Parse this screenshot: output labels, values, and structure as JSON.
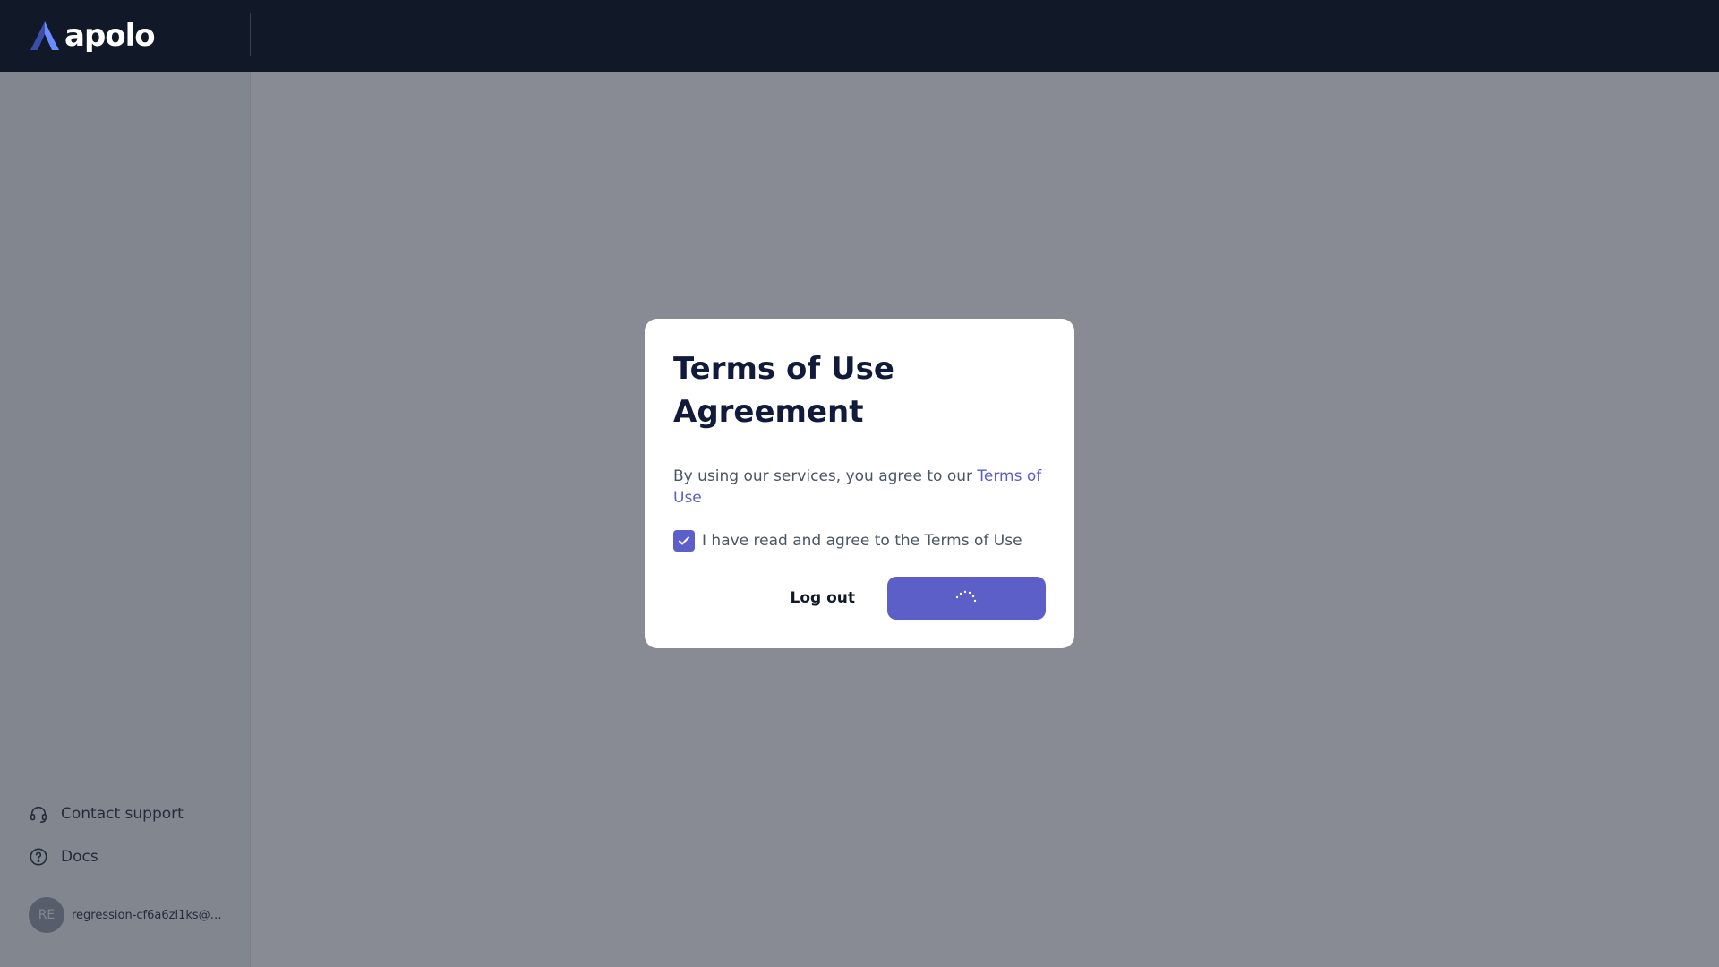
{
  "brand": {
    "name": "apolo",
    "logo_icon": "apolo-logo-icon"
  },
  "sidebar": {
    "links": [
      {
        "label": "Contact support",
        "icon": "headset-icon"
      },
      {
        "label": "Docs",
        "icon": "question-circle-icon"
      }
    ],
    "user": {
      "initials": "RE",
      "email": "regression-cf6a6zl1ks@ap..."
    }
  },
  "modal": {
    "title": "Terms of Use Agreement",
    "text_prefix": "By using our services, you agree to our ",
    "text_link": "Terms of Use",
    "checkbox_label": "I have read and agree to the Terms of Use",
    "checkbox_checked": true,
    "logout_label": "Log out",
    "accept_state": "loading"
  },
  "colors": {
    "topbar": "#111827",
    "accent": "#5b5fc7",
    "title": "#111a3a"
  }
}
